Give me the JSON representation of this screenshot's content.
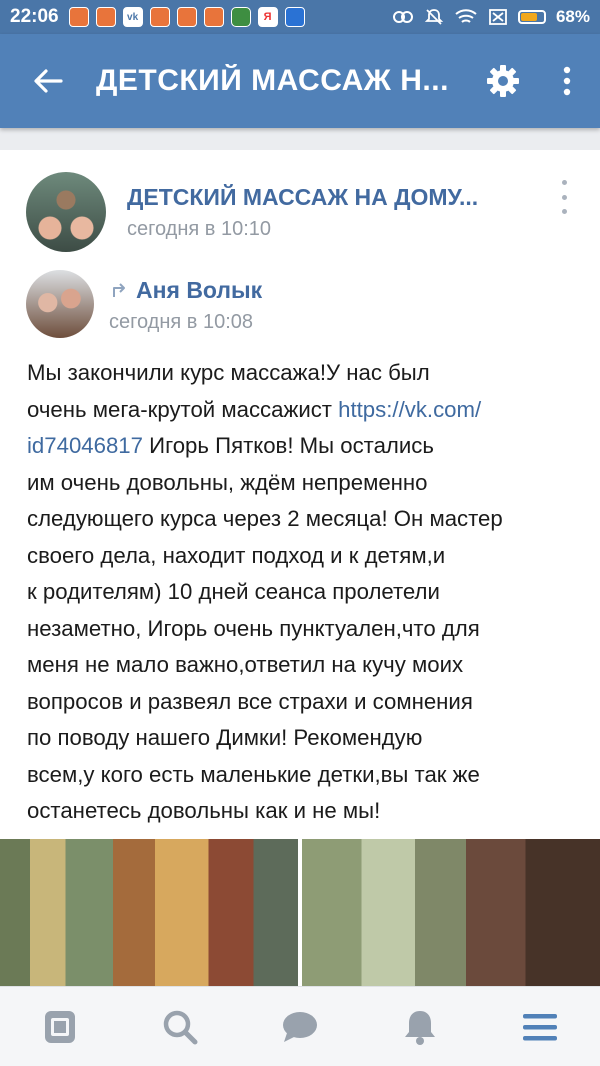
{
  "status_bar": {
    "time": "22:06",
    "battery": "68%",
    "battery_level": 0.68,
    "notification_icons": [
      "app-icon",
      "app-icon",
      "vk-icon",
      "app-icon",
      "app-icon",
      "app-icon",
      "shield-icon",
      "yandex-icon",
      "app-icon"
    ]
  },
  "app_bar": {
    "title": "ДЕТСКИЙ МАССАЖ Н...",
    "back_icon": "arrow-left-icon",
    "settings_icon": "gear-icon",
    "more_icon": "more-vertical-icon"
  },
  "post": {
    "group_name": "ДЕТСКИЙ МАССАЖ НА ДОМУ...",
    "group_time": "сегодня в 10:10",
    "repost": {
      "author": "Аня Волык",
      "time": "сегодня в 10:08"
    },
    "text_lines": [
      {
        "text": "Мы закончили курс массажа!У нас был"
      },
      {
        "text": "очень мега-крутой массажист ",
        "link": "https://vk.com/"
      },
      {
        "link": "id74046817",
        "text": " Игорь Пятков! Мы остались"
      },
      {
        "text": "им очень довольны, ждём непременно"
      },
      {
        "text": "следующего курса через 2 месяца! Он мастер"
      },
      {
        "text": "своего дела, находит подход и к детям,и"
      },
      {
        "text": "к родителям) 10 дней сеанса пролетели"
      },
      {
        "text": "незаметно, Игорь очень пунктуален,что для"
      },
      {
        "text": "меня не мало важно,ответил на кучу моих"
      },
      {
        "text": "вопросов и развеял все страхи и сомнения"
      },
      {
        "text": "по поводу нашего Димки! Рекомендую"
      },
      {
        "text": "всем,у кого есть маленькие детки,вы так же"
      },
      {
        "text": "останетесь довольны как и не мы!"
      }
    ]
  },
  "bottom_nav": {
    "items": [
      "news-icon",
      "search-icon",
      "messages-icon",
      "notifications-icon",
      "menu-icon"
    ],
    "active": "menu-icon"
  },
  "colors": {
    "app_bar": "#5181b8",
    "status_bar": "#4a76a8",
    "link": "#426aa0",
    "muted": "#939aa3",
    "nav_inactive": "#99a2ad",
    "nav_active": "#5181b8"
  }
}
